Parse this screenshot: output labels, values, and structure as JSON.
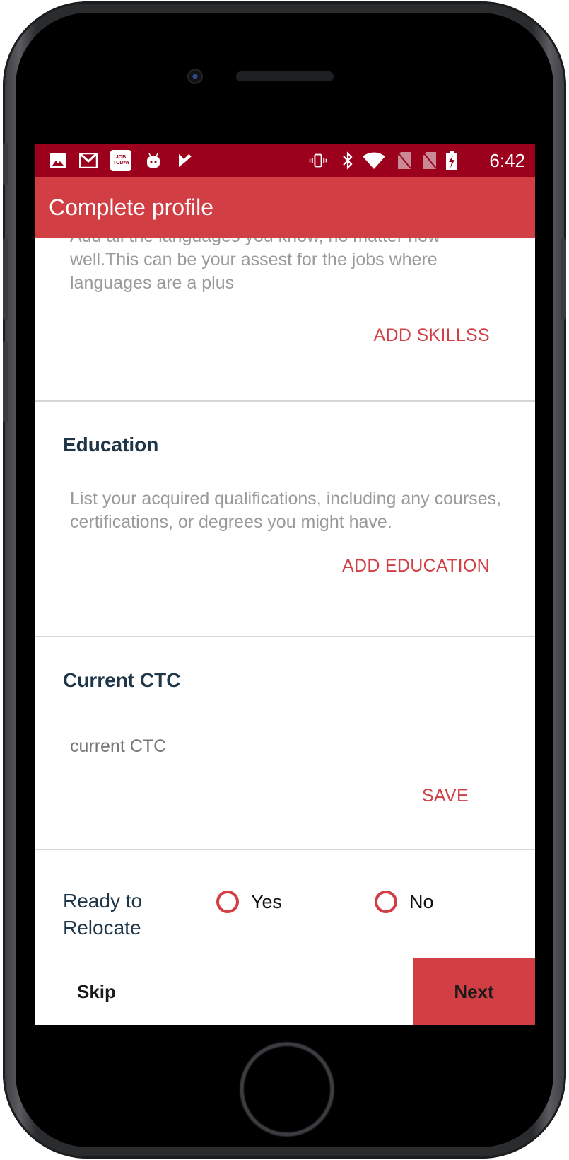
{
  "status_bar": {
    "left_icons": [
      "image-icon",
      "gmail-icon",
      "job-today-app-icon",
      "android-debug-icon",
      "task-check-icon"
    ],
    "right_icons": [
      "vibrate-icon",
      "bluetooth-icon",
      "wifi-icon",
      "no-sim-icon",
      "no-sim-icon",
      "battery-charging-icon"
    ],
    "job_today_text": "JOB TODAY",
    "time": "6:42"
  },
  "app_bar": {
    "title": "Complete profile"
  },
  "sections": {
    "languages": {
      "description": "Add all the languages you know, no matter how well.This can be your assest for the jobs where languages are a plus",
      "action": "ADD SKILLSS"
    },
    "education": {
      "title": "Education",
      "description": "List your acquired qualifications, including any courses, certifications, or degrees you might have.",
      "action": "ADD EDUCATION"
    },
    "ctc": {
      "title": "Current CTC",
      "input_value": "",
      "input_placeholder": "current CTC",
      "action": "SAVE"
    }
  },
  "relocate": {
    "label": "Ready to Relocate",
    "options": [
      {
        "label": "Yes",
        "selected": false
      },
      {
        "label": "No",
        "selected": false
      }
    ]
  },
  "bottom_nav": {
    "skip": "Skip",
    "next": "Next"
  },
  "colors": {
    "status_bar": "#9b001c",
    "primary": "#d13f45",
    "heading": "#1f3548",
    "muted_text": "#9a9a9a"
  }
}
